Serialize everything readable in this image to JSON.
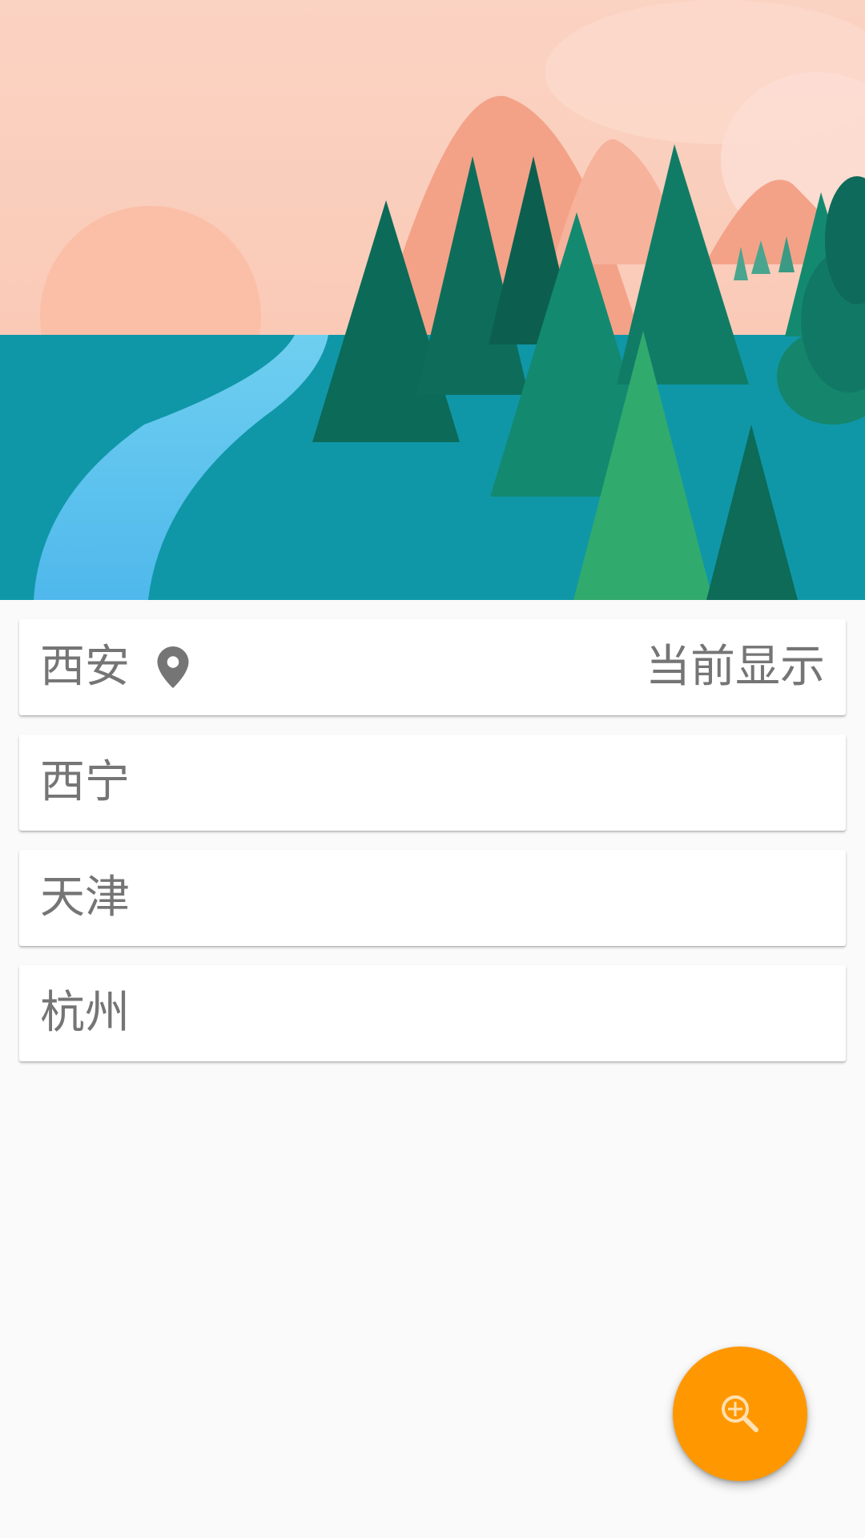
{
  "hero": {
    "image": "landscape-illustration"
  },
  "cities": [
    {
      "name": "西安",
      "icon": "location-pin-icon",
      "current_label": "当前显示"
    },
    {
      "name": "西宁"
    },
    {
      "name": "天津"
    },
    {
      "name": "杭州"
    }
  ],
  "fab": {
    "icon": "zoom-in-search-icon",
    "color": "#ff9800"
  },
  "colors": {
    "background": "#fafafa",
    "card": "#ffffff",
    "text": "#757575",
    "accent": "#ff9800"
  }
}
